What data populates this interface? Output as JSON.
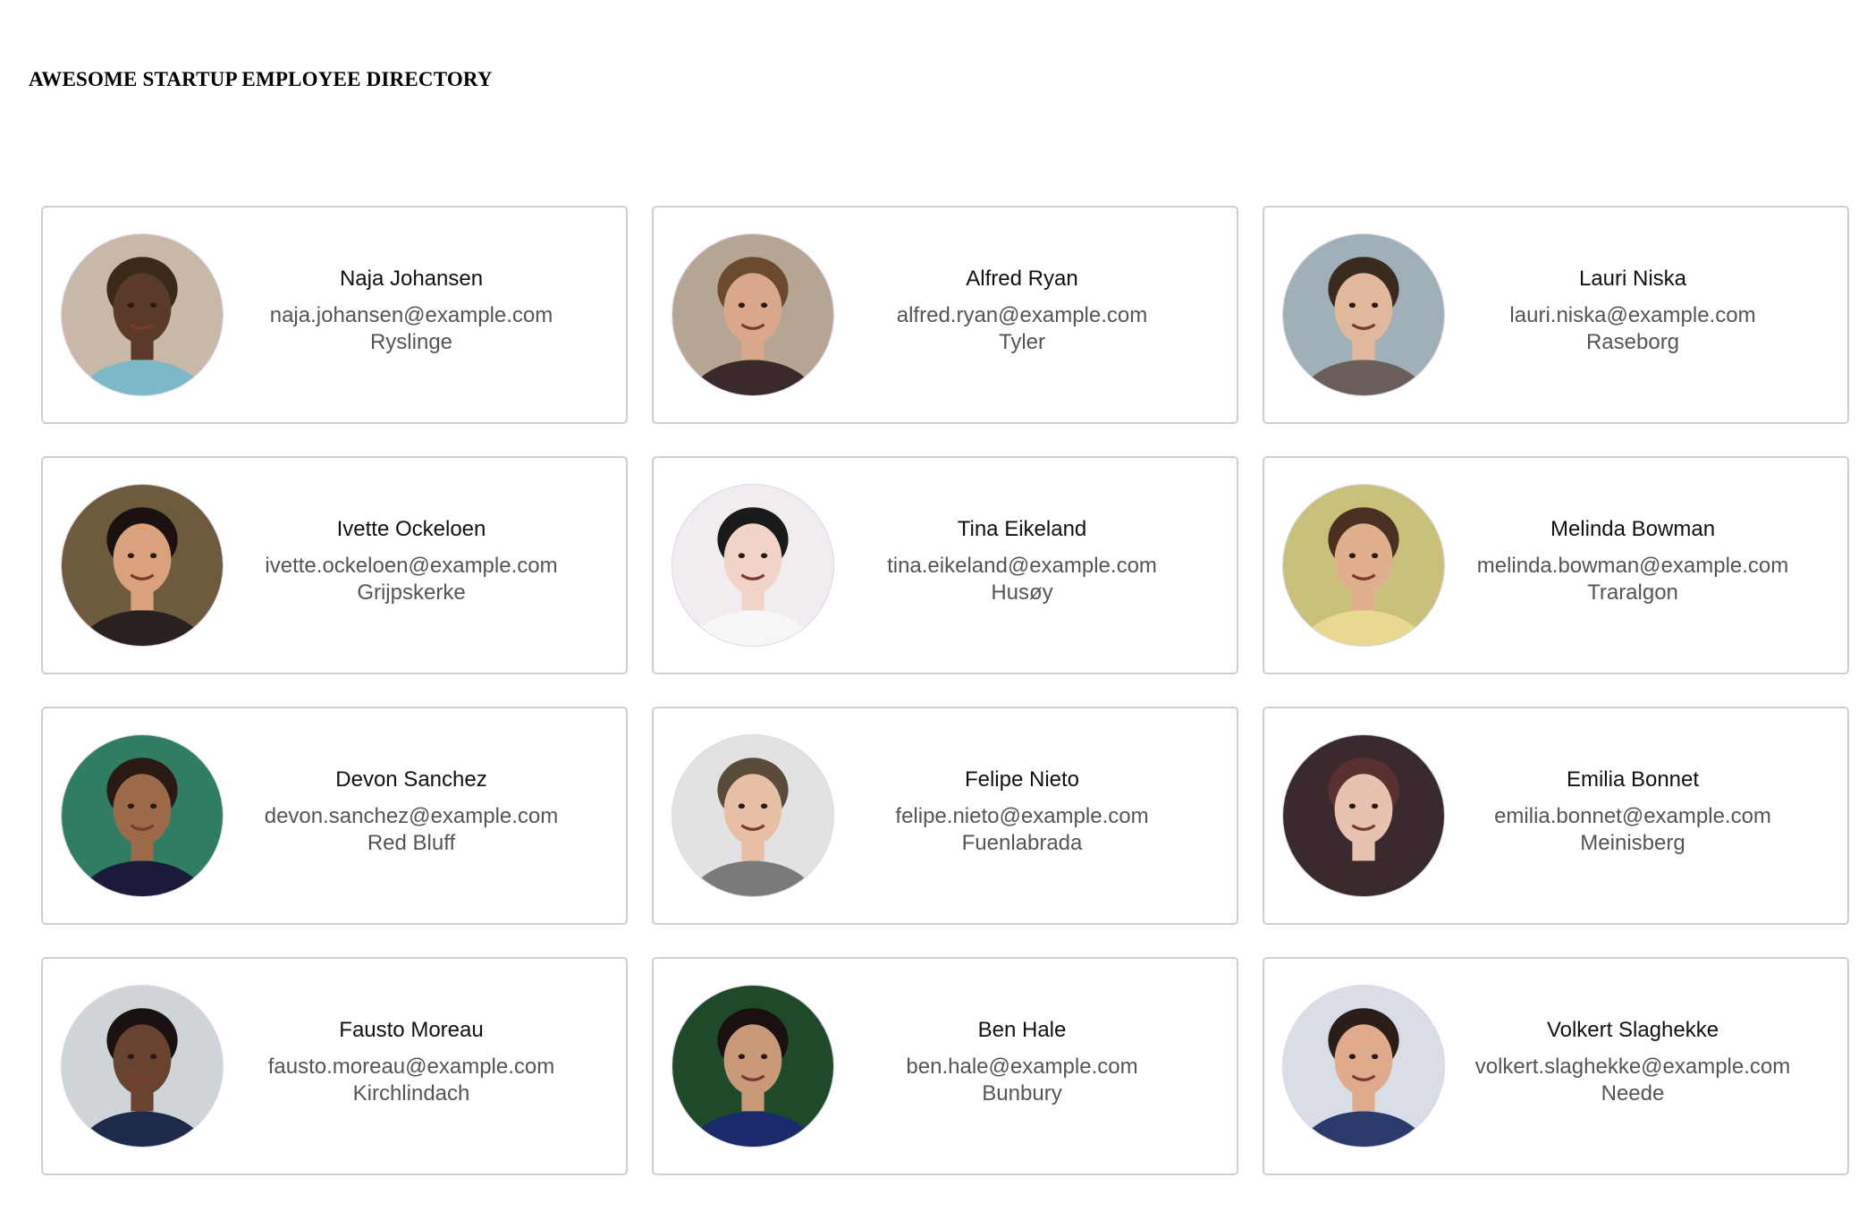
{
  "page": {
    "title": "AWESOME STARTUP EMPLOYEE DIRECTORY"
  },
  "employees": [
    {
      "name": "Naja Johansen",
      "email": "naja.johansen@example.com",
      "city": "Ryslinge",
      "bg": "#c9b8a8",
      "skin": "#5a3a28",
      "hair": "#3a2a1a",
      "shirt": "#7bb8c9"
    },
    {
      "name": "Alfred Ryan",
      "email": "alfred.ryan@example.com",
      "city": "Tyler",
      "bg": "#b7a594",
      "skin": "#d9a88a",
      "hair": "#6b4a30",
      "shirt": "#3a2a2a"
    },
    {
      "name": "Lauri Niska",
      "email": "lauri.niska@example.com",
      "city": "Raseborg",
      "bg": "#9fb0b8",
      "skin": "#e2b89c",
      "hair": "#3b2a20",
      "shirt": "#6a5f5a"
    },
    {
      "name": "Ivette Ockeloen",
      "email": "ivette.ockeloen@example.com",
      "city": "Grijpskerke",
      "bg": "#6e5a3c",
      "skin": "#d9a27c",
      "hair": "#1a1210",
      "shirt": "#2a2020"
    },
    {
      "name": "Tina Eikeland",
      "email": "tina.eikeland@example.com",
      "city": "Husøy",
      "bg": "#f0ecef",
      "skin": "#f1d3c8",
      "hair": "#1a1a1a",
      "shirt": "#f6f6f6"
    },
    {
      "name": "Melinda Bowman",
      "email": "melinda.bowman@example.com",
      "city": "Traralgon",
      "bg": "#c9c07a",
      "skin": "#e0b08e",
      "hair": "#4a3020",
      "shirt": "#e8d890"
    },
    {
      "name": "Devon Sanchez",
      "email": "devon.sanchez@example.com",
      "city": "Red Bluff",
      "bg": "#2f7d63",
      "skin": "#9c6a48",
      "hair": "#2a1a14",
      "shirt": "#1a1a3a"
    },
    {
      "name": "Felipe Nieto",
      "email": "felipe.nieto@example.com",
      "city": "Fuenlabrada",
      "bg": "#e2e2e2",
      "skin": "#e6bfa4",
      "hair": "#5a4a3a",
      "shirt": "#7a7a7a"
    },
    {
      "name": "Emilia Bonnet",
      "email": "emilia.bonnet@example.com",
      "city": "Meinisberg",
      "bg": "#3a2a2e",
      "skin": "#e8c2b0",
      "hair": "#5a3030",
      "shirt": "#3a2a2a"
    },
    {
      "name": "Fausto Moreau",
      "email": "fausto.moreau@example.com",
      "city": "Kirchlindach",
      "bg": "#cfd4d8",
      "skin": "#6a4330",
      "hair": "#1a1210",
      "shirt": "#1e2a4a"
    },
    {
      "name": "Ben Hale",
      "email": "ben.hale@example.com",
      "city": "Bunbury",
      "bg": "#1e4a2a",
      "skin": "#c89a7a",
      "hair": "#1a1010",
      "shirt": "#1a2a6a"
    },
    {
      "name": "Volkert Slaghekke",
      "email": "volkert.slaghekke@example.com",
      "city": "Neede",
      "bg": "#d8dde6",
      "skin": "#e0ab8c",
      "hair": "#2a1e18",
      "shirt": "#2a3a6a"
    }
  ]
}
